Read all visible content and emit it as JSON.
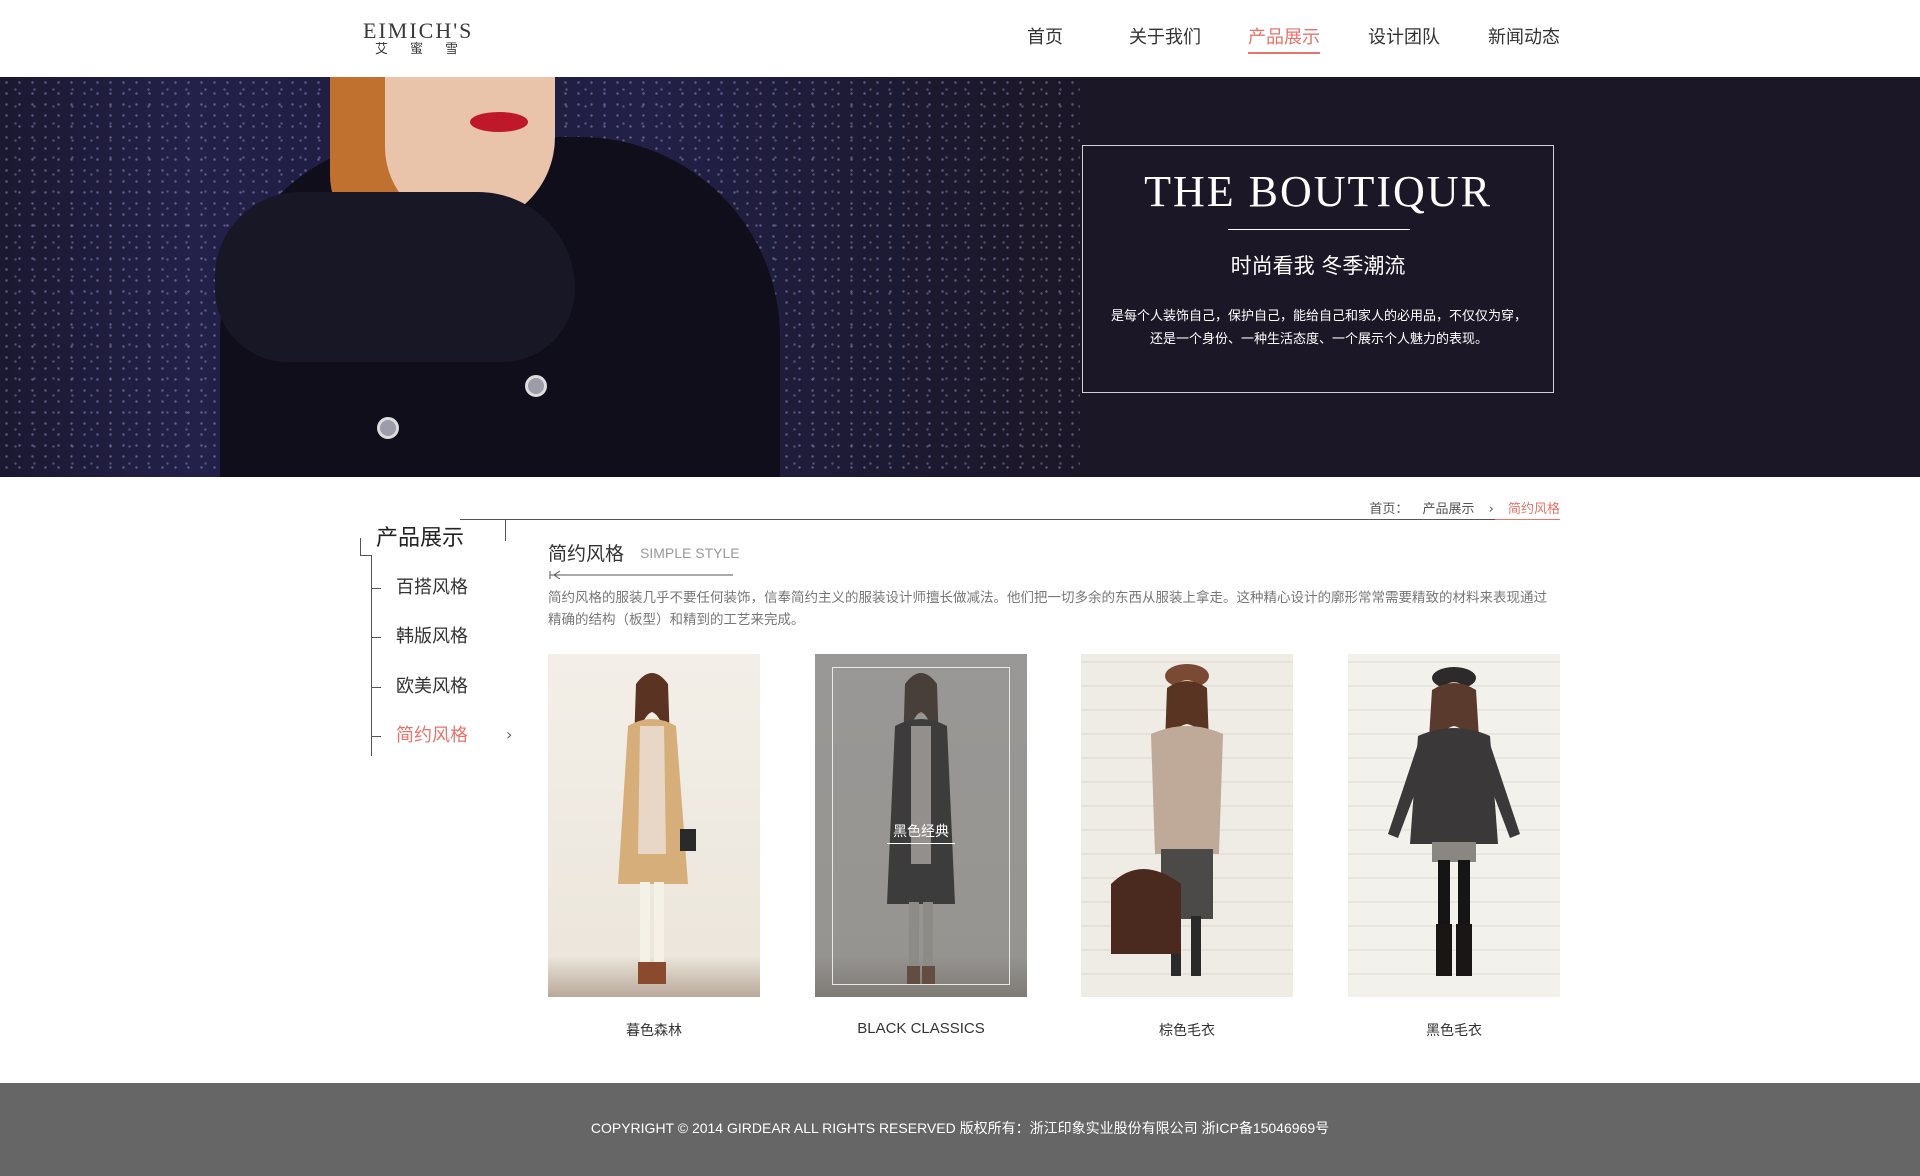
{
  "header": {
    "logo_en": "EIMICH'S",
    "logo_cn": "艾蜜雪",
    "nav": [
      {
        "label": "首页"
      },
      {
        "label": "关于我们"
      },
      {
        "label": "产品展示",
        "active": true
      },
      {
        "label": "设计团队"
      },
      {
        "label": "新闻动态"
      }
    ]
  },
  "banner": {
    "title": "THE BOUTIQUR",
    "subtitle": "时尚看我 冬季潮流",
    "description": "是每个人装饰自己，保护自己，能给自己和家人的必用品，不仅仅为穿，还是一个身份、一种生活态度、一个展示个人魅力的表现。"
  },
  "breadcrumb": {
    "home": "首页：",
    "parent": "产品展示",
    "separator": "›",
    "current": "简约风格"
  },
  "sidebar": {
    "title": "产品展示",
    "items": [
      {
        "label": "百搭风格"
      },
      {
        "label": "韩版风格"
      },
      {
        "label": "欧美风格"
      },
      {
        "label": "简约风格",
        "active": true
      }
    ],
    "active_arrow": "›"
  },
  "section": {
    "title_cn": "简约风格",
    "title_en": "SIMPLE STYLE",
    "intro": "简约风格的服装几乎不要任何装饰，信奉简约主义的服装设计师擅长做减法。他们把一切多余的东西从服装上拿走。这种精心设计的廓形常常需要精致的材料来表现通过精确的结构（板型）和精到的工艺来完成。"
  },
  "products": [
    {
      "name": "暮色森林"
    },
    {
      "name": "BLACK CLASSICS",
      "overlay_label": "黑色经典"
    },
    {
      "name": "棕色毛衣"
    },
    {
      "name": "黑色毛衣"
    }
  ],
  "footer": {
    "copyright": "COPYRIGHT © 2014 GIRDEAR ALL RIGHTS RESERVED 版权所有：浙江印象实业股份有限公司  浙ICP备15046969号"
  },
  "colors": {
    "accent": "#e8736b",
    "banner_bg": "#1c1727",
    "footer_bg": "#666666"
  }
}
